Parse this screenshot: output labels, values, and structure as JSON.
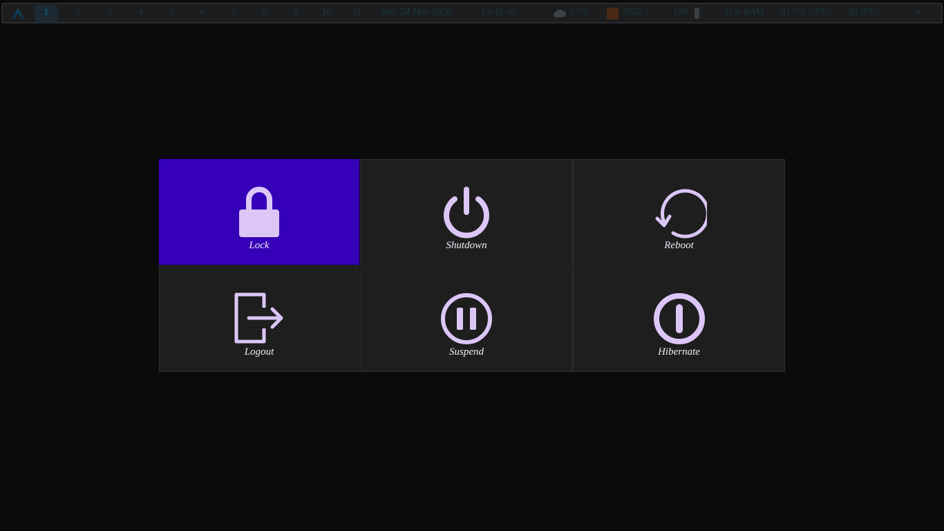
{
  "topbar": {
    "workspaces": [
      "1",
      "2",
      "3",
      "4",
      "5",
      "6",
      "7",
      "8",
      "9",
      "10",
      "11"
    ],
    "active_workspace": "1",
    "date": "Sun, 24 May 2026",
    "time": "19:41:42",
    "weather": "15°C",
    "network": "2053 ...",
    "volume": "100",
    "ram": "11% RAM",
    "cpu": "31.7% CPU",
    "temperature": "63.0°C",
    "layout": "rt"
  },
  "power_menu": {
    "lock": "Lock",
    "shutdown": "Shutdown",
    "reboot": "Reboot",
    "logout": "Logout",
    "suspend": "Suspend",
    "hibernate": "Hibernate",
    "selected": "lock"
  },
  "icons": {
    "lock": "lock-icon",
    "shutdown": "power-icon",
    "reboot": "reboot-icon",
    "logout": "logout-icon",
    "suspend": "pause-icon",
    "hibernate": "hibernate-icon"
  },
  "colors": {
    "selected_tile": "#3500b8",
    "tile": "#1e1e1e",
    "icon": "#dcc6f7",
    "label": "#f2ecf8",
    "background": "#0b0b0b"
  }
}
